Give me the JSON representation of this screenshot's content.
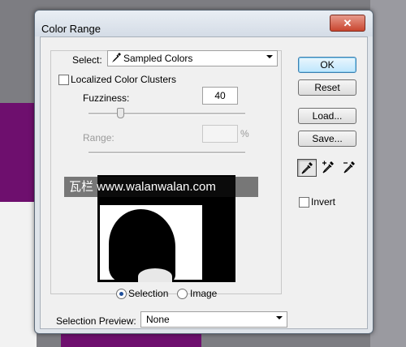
{
  "dialog": {
    "title": "Color Range",
    "close_label": "✕"
  },
  "select": {
    "label": "Select:",
    "value": "Sampled Colors",
    "icon": "eyedropper-icon"
  },
  "localized": {
    "label": "Localized Color Clusters",
    "checked": false
  },
  "fuzziness": {
    "label": "Fuzziness:",
    "value": "40",
    "slider_fraction": 0.2
  },
  "range": {
    "label": "Range:",
    "value": "",
    "unit": "%"
  },
  "watermark": {
    "text": "瓦栏 www.walanwalan.com"
  },
  "view": {
    "options": [
      "Selection",
      "Image"
    ],
    "selected": "Selection"
  },
  "preview_select": {
    "label": "Selection Preview:",
    "value": "None"
  },
  "buttons": {
    "ok": "OK",
    "cancel": "Reset",
    "load": "Load...",
    "save": "Save..."
  },
  "tools": [
    "eyedropper-icon",
    "eyedropper-plus-icon",
    "eyedropper-minus-icon"
  ],
  "invert": {
    "label": "Invert",
    "checked": false
  },
  "colors": {
    "background_purple": "#6e0f6e",
    "accent_blue": "#3c7fb1"
  }
}
